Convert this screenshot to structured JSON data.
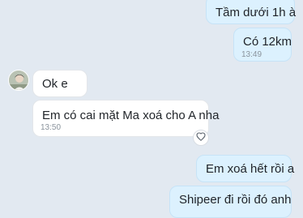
{
  "chat": {
    "messages": [
      {
        "direction": "outgoing",
        "text": "Tầm dưới 1h à",
        "time": ""
      },
      {
        "direction": "outgoing",
        "text": "Có 12km",
        "time": "13:49"
      },
      {
        "direction": "incoming",
        "text": "Ok e",
        "time": ""
      },
      {
        "direction": "incoming",
        "text": "Em có cai mặt Ma xoá cho A nha",
        "time": "13:50"
      },
      {
        "direction": "outgoing",
        "text": "Em xoá hết rồi a",
        "time": ""
      },
      {
        "direction": "outgoing",
        "text": "Shipeer đi rồi đó anh",
        "time": ""
      }
    ],
    "icons": {
      "reaction": "heart-outline-icon",
      "avatar": "contact-avatar"
    },
    "colors": {
      "background": "#e2e9f1",
      "outgoing_bubble": "#dcf1fe",
      "incoming_bubble": "#ffffff"
    }
  }
}
